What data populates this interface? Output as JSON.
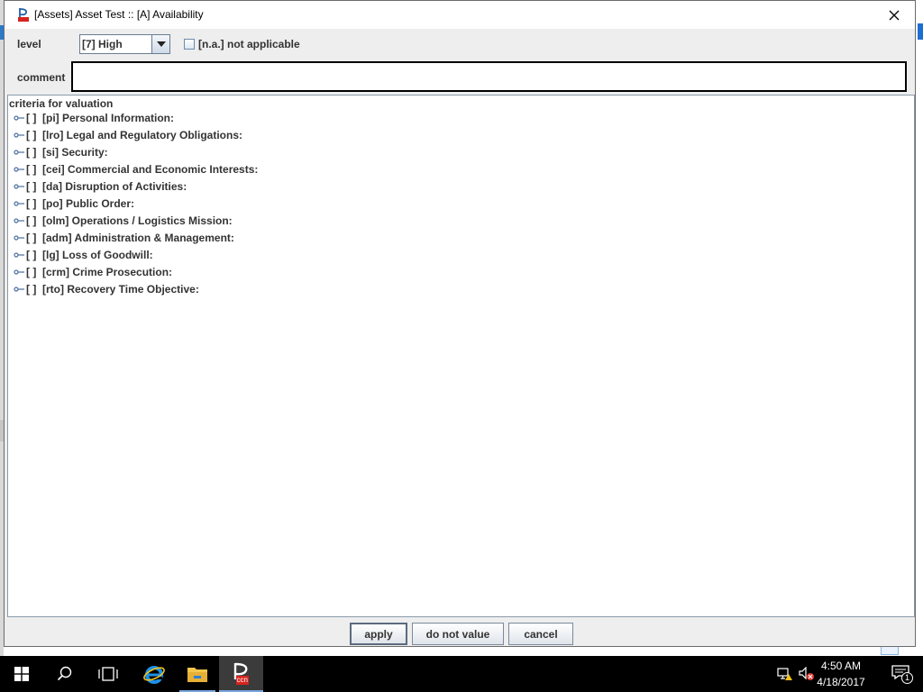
{
  "window": {
    "title": "[Assets] Asset Test :: [A] Availability"
  },
  "form": {
    "level_label": "level",
    "level_value": "[7] High",
    "na_label": "[n.a.] not applicable",
    "na_checked": false,
    "comment_label": "comment",
    "comment_value": ""
  },
  "criteria": {
    "title": "criteria for valuation",
    "items": [
      "[ ]  [pi] Personal Information:",
      "[ ]  [lro] Legal and Regulatory Obligations:",
      "[ ]  [si] Security:",
      "[ ]  [cei] Commercial and Economic Interests:",
      "[ ]  [da] Disruption of Activities:",
      "[ ]  [po] Public Order:",
      "[ ]  [olm] Operations / Logistics Mission:",
      "[ ]  [adm] Administration & Management:",
      "[ ]  [lg] Loss of Goodwill:",
      "[ ]  [crm] Crime Prosecution:",
      "[ ]  [rto] Recovery Time Objective:"
    ]
  },
  "buttons": {
    "apply": "apply",
    "do_not_value": "do not value",
    "cancel": "cancel"
  },
  "taskbar": {
    "time": "4:50 AM",
    "date": "4/18/2017",
    "notification_count": "1",
    "app_icon_text": "ccn"
  },
  "icons": {
    "start": "windows-logo-icon",
    "search": "search-icon",
    "task_view": "task-view-icon",
    "browser": "internet-explorer-icon",
    "explorer": "file-explorer-icon",
    "pilar": "pilar-app-icon",
    "network": "network-icon",
    "volume": "volume-muted-icon",
    "notifications": "action-center-icon"
  }
}
